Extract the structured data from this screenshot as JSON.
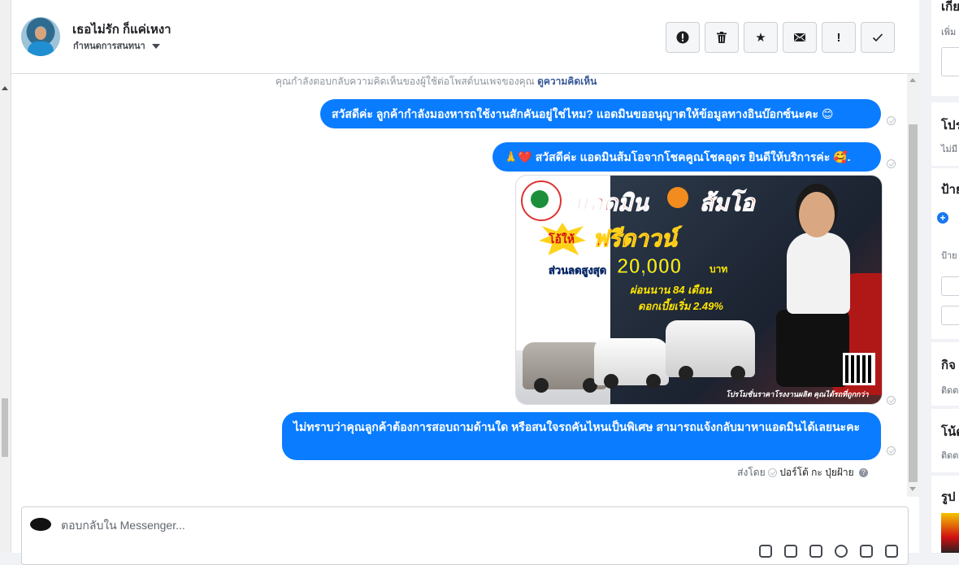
{
  "header": {
    "contact_name": "เธอไม่รัก ก็แค่เหงา",
    "assign_label": "กำหนดการสนทนา",
    "actions": [
      {
        "name": "report-spam-button",
        "icon": "alert-circle-icon",
        "glyph": "!"
      },
      {
        "name": "delete-button",
        "icon": "trash-icon",
        "glyph": ""
      },
      {
        "name": "star-button",
        "icon": "star-icon",
        "glyph": "★"
      },
      {
        "name": "mark-unread-button",
        "icon": "envelope-icon",
        "glyph": ""
      },
      {
        "name": "follow-up-button",
        "icon": "exclamation-icon",
        "glyph": "!"
      },
      {
        "name": "mark-done-button",
        "icon": "check-icon",
        "glyph": "✓"
      }
    ]
  },
  "thread": {
    "notice_text": "คุณกำลังตอบกลับความคิดเห็นของผู้ใช้ต่อโพสต์บนเพจของคุณ",
    "notice_link": "ดูความคิดเห็น",
    "messages": [
      "สวัสดีค่ะ ลูกค้ากำลังมองหารถใช้งานสักคันอยู่ใช่ไหม? แอดมินขออนุญาตให้ข้อมูลทางอินบ๊อกซ์นะคะ 😊",
      "🙏❤️ สวัสดีค่ะ แอดมินส้มโอจากโชคคูณโชคอุดร ยินดีให้บริการค่ะ 🥰.",
      "ไม่ทราบว่าคุณลูกค้าต้องการสอบถามด้านใด หรือสนใจรถคันไหนเป็นพิเศษ สามารถแจ้งกลับมาหาแอดมินได้เลยนะคะ"
    ],
    "promo_image": {
      "admin_text": "แอดมิน",
      "name_text": "ส้มโอ",
      "give_text": "โอ้ให้",
      "free_down_text": "ฟรีดาวน์",
      "discount_label": "ส่วนลดสูงสุด",
      "discount_amount": "20,000",
      "baht": "บาท",
      "installment_text": "ผ่อนนาน 84 เดือน",
      "interest_text": "ดอกเบี้ยเริ่ม 2.49%",
      "footer_text": "โปรโมชั่นราคาโรงงานผลิต คุณได้รถที่ถูกกว่า"
    },
    "sent_by_label": "ส่งโดย",
    "sent_by_name": "ปอร์โต้ กะ ปุ่ยฝ้าย"
  },
  "composer": {
    "placeholder": "ตอบกลับใน Messenger..."
  },
  "right_panel": {
    "sections": [
      {
        "title": "เกี่ย",
        "sub": "เพิ่ม"
      },
      {
        "title": "โปร",
        "sub": "ไม่มี"
      },
      {
        "title": "ป้าย",
        "sub": "ป้าย"
      },
      {
        "title": "กิจ",
        "sub": "ติดต"
      },
      {
        "title": "โน้ต",
        "sub": "ติดต"
      },
      {
        "title": "รูป",
        "sub": ""
      }
    ]
  },
  "colors": {
    "bubble": "#0a7cff",
    "accent": "#1877f2"
  }
}
